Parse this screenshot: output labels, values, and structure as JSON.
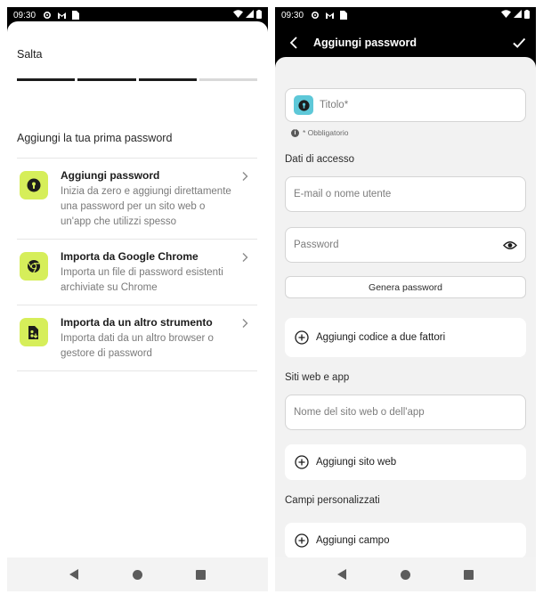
{
  "status_bar": {
    "time": "09:30"
  },
  "left_screen": {
    "skip_label": "Salta",
    "progress": {
      "total_steps": 4,
      "completed_steps": 3
    },
    "section_title": "Aggiungi la tua prima password",
    "options": [
      {
        "icon": "keyhole-icon",
        "title": "Aggiungi password",
        "description": "Inizia da zero e aggiungi direttamente una password per un sito web o un'app che utilizzi spesso"
      },
      {
        "icon": "chrome-icon",
        "title": "Importa da Google Chrome",
        "description": "Importa un file di password esistenti archiviate su Chrome"
      },
      {
        "icon": "file-import-icon",
        "title": "Importa da un altro strumento",
        "description": "Importa dati da un altro browser o gestore di password"
      }
    ]
  },
  "right_screen": {
    "header_title": "Aggiungi password",
    "title_field": {
      "placeholder": "Titolo*"
    },
    "required_note": "* Obbligatorio",
    "access_section": "Dati di accesso",
    "username_field": {
      "placeholder": "E-mail o nome utente"
    },
    "password_field": {
      "placeholder": "Password"
    },
    "generate_button": "Genera password",
    "add_2fa_label": "Aggiungi codice a due fattori",
    "websites_section": "Siti web e app",
    "website_field": {
      "placeholder": "Nome del sito web o dell'app"
    },
    "add_website_label": "Aggiungi sito web",
    "custom_fields_section": "Campi personalizzati",
    "add_field_label": "Aggiungi campo"
  },
  "colors": {
    "accent_lime": "#d6ee5a",
    "accent_teal": "#5ec8d8",
    "background_form": "#f2f2f2"
  }
}
